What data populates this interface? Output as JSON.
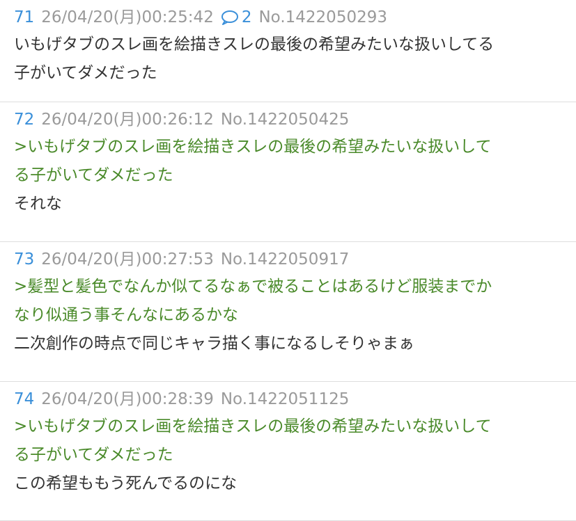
{
  "posts": [
    {
      "number": "71",
      "date": "26/04/20(月)00:25:42",
      "reply_count": "2",
      "id": "No.1422050293",
      "lines": [
        {
          "type": "text",
          "content": "いもげタブのスレ画を絵描きスレの最後の希望みたいな扱いしてる"
        },
        {
          "type": "text",
          "content": "子がいてダメだった"
        }
      ]
    },
    {
      "number": "72",
      "date": "26/04/20(月)00:26:12",
      "id": "No.1422050425",
      "lines": [
        {
          "type": "quote",
          "content": ">いもげタブのスレ画を絵描きスレの最後の希望みたいな扱いして"
        },
        {
          "type": "quote",
          "content": "る子がいてダメだった"
        },
        {
          "type": "text",
          "content": "それな"
        }
      ]
    },
    {
      "number": "73",
      "date": "26/04/20(月)00:27:53",
      "id": "No.1422050917",
      "lines": [
        {
          "type": "quote",
          "content": ">髪型と髪色でなんか似てるなぁで被ることはあるけど服装までか"
        },
        {
          "type": "quote",
          "content": "なり似通う事そんなにあるかな"
        },
        {
          "type": "text",
          "content": "二次創作の時点で同じキャラ描く事になるしそりゃまぁ"
        }
      ]
    },
    {
      "number": "74",
      "date": "26/04/20(月)00:28:39",
      "id": "No.1422051125",
      "lines": [
        {
          "type": "quote",
          "content": ">いもげタブのスレ画を絵描きスレの最後の希望みたいな扱いして"
        },
        {
          "type": "quote",
          "content": "る子がいてダメだった"
        },
        {
          "type": "text",
          "content": "この希望ももう死んでるのにな"
        }
      ]
    }
  ],
  "icons": {
    "reply": "speech-bubble-icon"
  },
  "colors": {
    "post_number": "#3a8fd9",
    "quote": "#4a8a2a",
    "meta": "#9a9a9a",
    "text": "#333333",
    "divider": "#dddddd"
  }
}
